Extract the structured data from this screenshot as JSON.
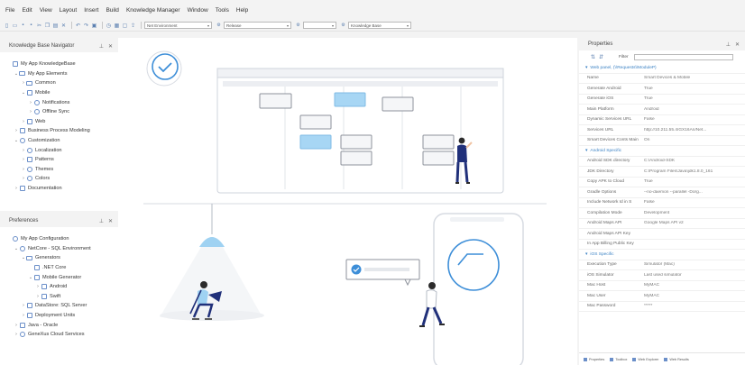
{
  "menu": [
    "File",
    "Edit",
    "View",
    "Layout",
    "Insert",
    "Build",
    "Knowledge Manager",
    "Window",
    "Tools",
    "Help"
  ],
  "toolbar": {
    "environment": "Net Environment",
    "configuration": "Release",
    "platform": "",
    "kb_selector": "Knowledge Base"
  },
  "kb_navigator": {
    "title": "Knowledge Base Navigator",
    "items": [
      {
        "label": "My App KnowledgeBase",
        "icon": "kb-icon"
      },
      {
        "label": "My App Elements",
        "icon": "elements-icon"
      },
      {
        "label": "Common",
        "icon": "folder-icon"
      },
      {
        "label": "Mobile",
        "icon": "mobile-icon"
      },
      {
        "label": "Notifications",
        "icon": "notification-icon"
      },
      {
        "label": "Offline Sync",
        "icon": "sync-icon"
      },
      {
        "label": "Web",
        "icon": "web-icon"
      },
      {
        "label": "Business Process Modeling",
        "icon": "bpm-icon"
      },
      {
        "label": "Customization",
        "icon": "customization-icon"
      },
      {
        "label": "Localization",
        "icon": "localization-icon"
      },
      {
        "label": "Patterns",
        "icon": "patterns-icon"
      },
      {
        "label": "Themes",
        "icon": "themes-icon"
      },
      {
        "label": "Colors",
        "icon": "colors-icon"
      },
      {
        "label": "Documentation",
        "icon": "documentation-icon"
      }
    ]
  },
  "preferences": {
    "title": "Preferences",
    "items": [
      {
        "label": "My App Configuration",
        "icon": "config-icon"
      },
      {
        "label": "NetCore - SQL Environment",
        "icon": "environment-icon"
      },
      {
        "label": "Generators",
        "icon": "generators-icon"
      },
      {
        "label": ".NET Core",
        "icon": "generator-icon"
      },
      {
        "label": "Mobile Generator",
        "icon": "mobile-generator-icon"
      },
      {
        "label": "Android",
        "icon": "android-icon"
      },
      {
        "label": "Swift",
        "icon": "swift-icon"
      },
      {
        "label": "DataStore: SQL Server",
        "icon": "datastore-icon"
      },
      {
        "label": "Deployment Units",
        "icon": "deployment-icon"
      },
      {
        "label": "Java - Oracle",
        "icon": "environment-icon"
      },
      {
        "label": "GeneXus Cloud Services",
        "icon": "cloud-icon"
      }
    ]
  },
  "properties": {
    "title": "Properties",
    "filter_label": "Filter",
    "object_path": "Web panel, (\\\\Requests\\\\ModuleP)",
    "rows": [
      {
        "type": "row",
        "k": "Name",
        "v": "Smart Devices & Mobile"
      },
      {
        "type": "row",
        "k": "Generate Android",
        "v": "True"
      },
      {
        "type": "row",
        "k": "Generate iOS",
        "v": "True"
      },
      {
        "type": "row",
        "k": "Main Platform",
        "v": "Android"
      },
      {
        "type": "row",
        "k": "Dynamic Services URL",
        "v": "False"
      },
      {
        "type": "row",
        "k": "Services URL",
        "v": "http://10.211.55.4/GX16An/Net..."
      },
      {
        "type": "row",
        "k": "Smart Devices Conts Main",
        "v": "On"
      },
      {
        "type": "section",
        "k": "Android Specific"
      },
      {
        "type": "row",
        "k": "Android SDK directory",
        "v": "C:\\Android-SDK"
      },
      {
        "type": "row",
        "k": "JDK Directory",
        "v": "C:\\Program Files\\Java\\jdk1.8.0_161"
      },
      {
        "type": "row",
        "k": "Copy APK to Cloud",
        "v": "True"
      },
      {
        "type": "row",
        "k": "Gradle Options",
        "v": "--no-daemon --parallel -Dorg..."
      },
      {
        "type": "row",
        "k": "Include Network Id in S",
        "v": "False"
      },
      {
        "type": "row",
        "k": "Compilation Mode",
        "v": "Development"
      },
      {
        "type": "row",
        "k": "Android Maps API",
        "v": "Google Maps API v2"
      },
      {
        "type": "row",
        "k": "Android Maps API Key",
        "v": ""
      },
      {
        "type": "row",
        "k": "In App Billing Public Key",
        "v": ""
      },
      {
        "type": "section",
        "k": "iOS Specific"
      },
      {
        "type": "row",
        "k": "Execution Type",
        "v": "Simulator (Mac)"
      },
      {
        "type": "row",
        "k": "iOS Simulator",
        "v": "Last used simulator"
      },
      {
        "type": "row",
        "k": "Mac Host",
        "v": "MyMAC"
      },
      {
        "type": "row",
        "k": "Mac User",
        "v": "MyMAC"
      },
      {
        "type": "row",
        "k": "Mac Password",
        "v": "*****"
      }
    ],
    "footer": [
      "Properties",
      "Toolbox",
      "Web Explorer",
      "Web Results"
    ]
  },
  "colors": {
    "accent": "#3b82c4",
    "illustration_blue": "#8ecbf0",
    "illustration_navy": "#1f2d6b"
  }
}
